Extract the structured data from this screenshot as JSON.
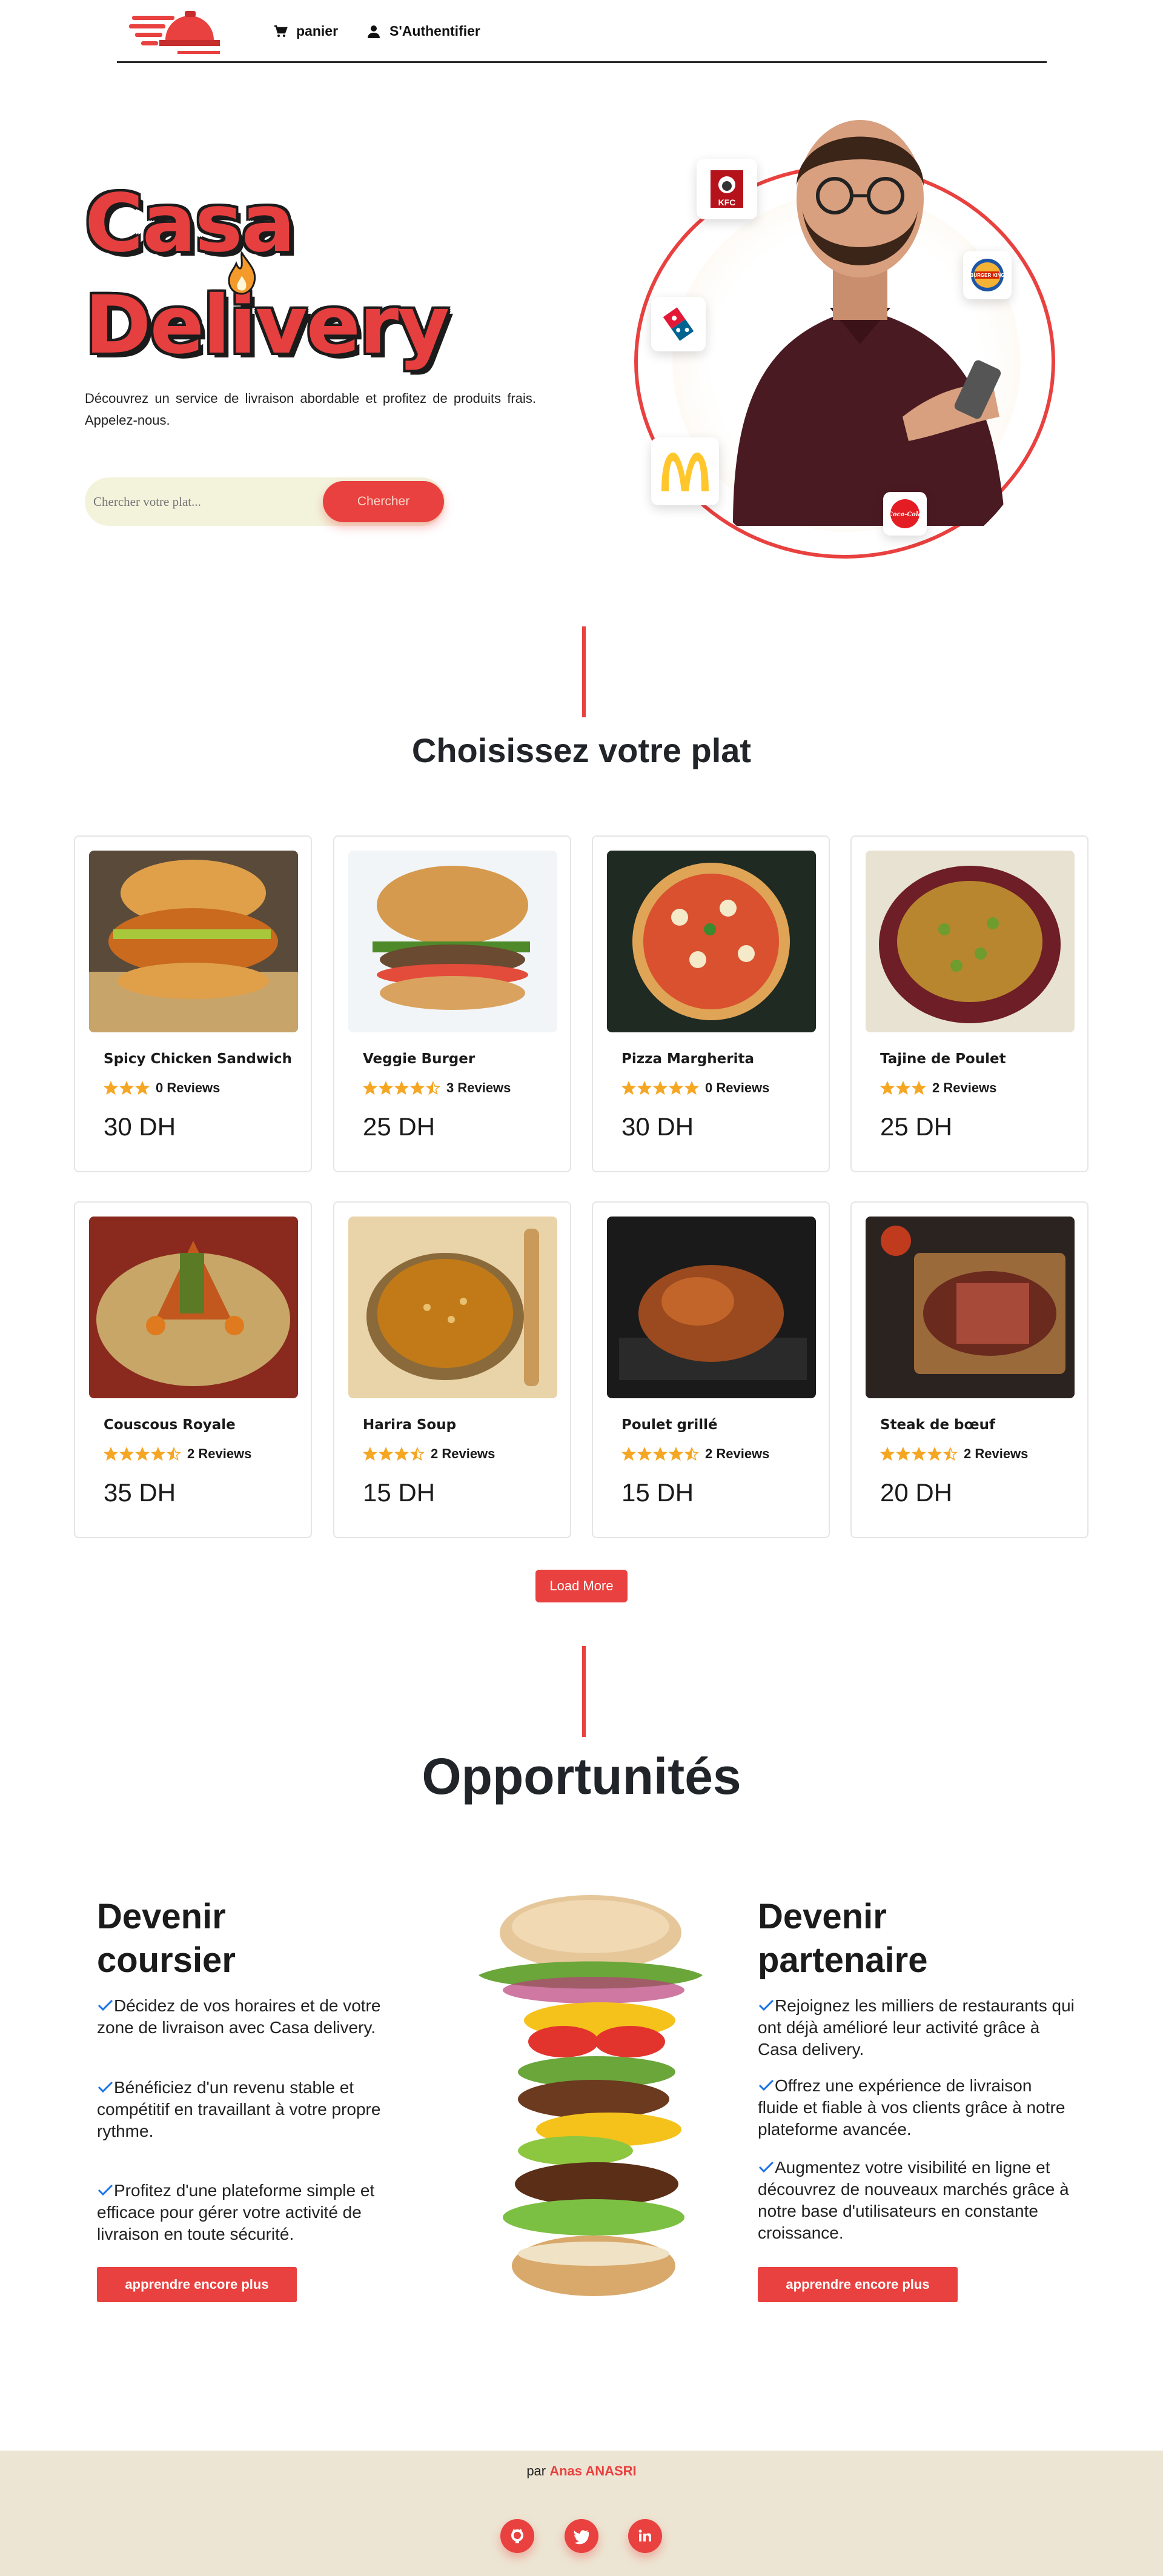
{
  "nav": {
    "cart_label": "panier",
    "login_label": "S'Authentifier"
  },
  "hero": {
    "title_line1": "Casa",
    "title_line2": "Delivery",
    "description": "Découvrez un service de livraison abordable et profitez de produits frais. Appelez-nous.",
    "search_placeholder": "Chercher votre plat...",
    "search_button": "Chercher",
    "brands": [
      "KFC",
      "Burger King",
      "Domino's",
      "McDonald's",
      "Coca-Cola"
    ]
  },
  "menu": {
    "title": "Choisissez votre plat",
    "items": [
      {
        "name": "Spicy Chicken Sandwich",
        "stars": 3,
        "reviews": "0 Reviews",
        "price": "30 DH"
      },
      {
        "name": "Veggie Burger",
        "stars": 4.5,
        "reviews": "3 Reviews",
        "price": "25 DH"
      },
      {
        "name": "Pizza Margherita",
        "stars": 5,
        "reviews": "0 Reviews",
        "price": "30 DH"
      },
      {
        "name": "Tajine de Poulet",
        "stars": 3,
        "reviews": "2 Reviews",
        "price": "25 DH"
      },
      {
        "name": "Couscous Royale",
        "stars": 4.5,
        "reviews": "2 Reviews",
        "price": "35 DH"
      },
      {
        "name": "Harira Soup",
        "stars": 3.5,
        "reviews": "2 Reviews",
        "price": "15 DH"
      },
      {
        "name": "Poulet grillé",
        "stars": 4.5,
        "reviews": "2 Reviews",
        "price": "15 DH"
      },
      {
        "name": "Steak de bœuf",
        "stars": 4.5,
        "reviews": "2 Reviews",
        "price": "20 DH"
      }
    ],
    "load_more": "Load More"
  },
  "opportunities": {
    "title": "Opportunités",
    "courier": {
      "title_line1": "Devenir",
      "title_line2": "coursier",
      "points": [
        "Décidez de vos horaires et de votre zone de livraison avec Casa delivery.",
        "Bénéficiez d'un revenu stable et compétitif en travaillant à votre propre rythme.",
        "Profitez d'une plateforme simple et efficace pour gérer votre activité de livraison en toute sécurité."
      ],
      "button": "apprendre encore plus"
    },
    "partner": {
      "title_line1": "Devenir",
      "title_line2": "partenaire",
      "points": [
        "Rejoignez les milliers de restaurants qui ont déjà amélioré leur activité grâce à Casa delivery.",
        "Offrez une expérience de livraison fluide et fiable à vos clients grâce à notre plateforme avancée.",
        "Augmentez votre visibilité en ligne et découvrez de nouveaux marchés grâce à notre base d'utilisateurs en constante croissance."
      ],
      "button": "apprendre encore plus"
    }
  },
  "footer": {
    "credit_prefix": "par",
    "author": "Anas ANASRI",
    "socials": [
      "github",
      "twitter",
      "linkedin"
    ]
  },
  "colors": {
    "accent": "#e8413f",
    "footer_bg": "#ede5d3",
    "star": "#f5a623"
  }
}
